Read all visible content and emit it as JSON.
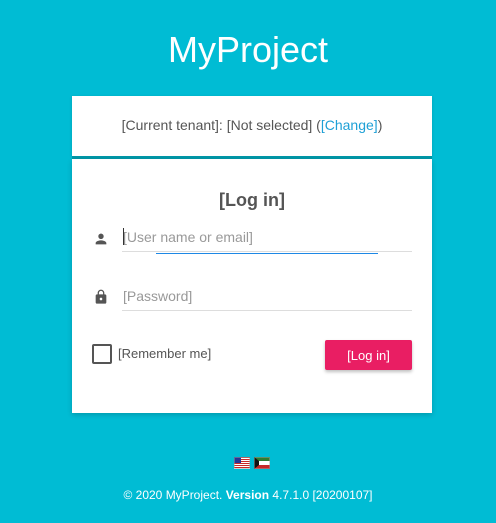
{
  "app": {
    "title": "MyProject"
  },
  "tenant": {
    "prefix": "[Current tenant]: [Not selected] (",
    "change_label": "[Change]",
    "suffix": ")"
  },
  "login": {
    "heading": "[Log in]",
    "username_placeholder": "[User name or email]",
    "username_value": "",
    "password_placeholder": "[Password]",
    "password_value": "",
    "remember_label": "[Remember me]",
    "remember_checked": false,
    "submit_label": "[Log in]"
  },
  "languages": [
    {
      "code": "en",
      "icon": "us-flag-icon"
    },
    {
      "code": "ar",
      "icon": "kuwait-flag-icon"
    }
  ],
  "footer": {
    "copyright": "© 2020 MyProject.",
    "version_label": "Version",
    "version_value": "4.7.1.0 [20200107]"
  },
  "colors": {
    "background": "#00bcd4",
    "divider": "#0097a7",
    "link": "#1ea0d6",
    "primary_button": "#e91e63",
    "focus_underline": "#1e88e5"
  },
  "icons": {
    "username": "person-icon",
    "password": "lock-icon"
  }
}
